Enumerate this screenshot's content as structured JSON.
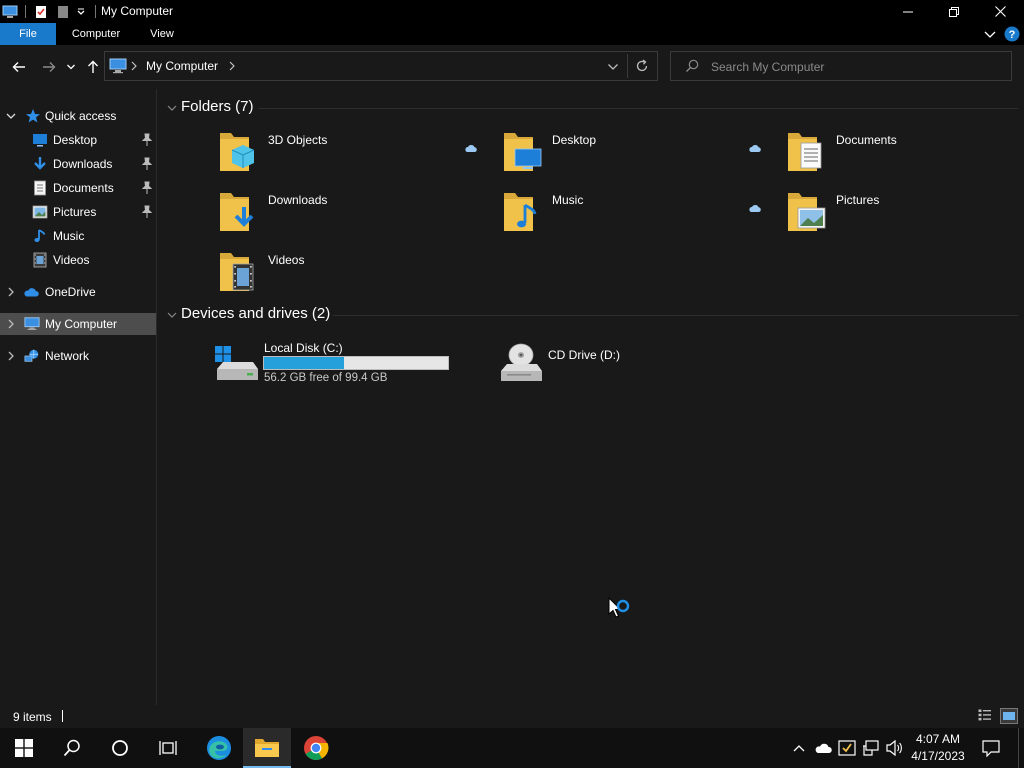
{
  "window": {
    "title": "My Computer"
  },
  "ribbon": {
    "tabs": [
      {
        "label": "File"
      },
      {
        "label": "Computer"
      },
      {
        "label": "View"
      }
    ]
  },
  "address": {
    "crumb": "My Computer",
    "search_placeholder": "Search My Computer"
  },
  "sidebar": {
    "quick_access": "Quick access",
    "quick_items": [
      {
        "label": "Desktop",
        "icon": "desktop-icon",
        "pinned": true
      },
      {
        "label": "Downloads",
        "icon": "downloads-icon",
        "pinned": true
      },
      {
        "label": "Documents",
        "icon": "documents-icon",
        "pinned": true
      },
      {
        "label": "Pictures",
        "icon": "pictures-icon",
        "pinned": true
      },
      {
        "label": "Music",
        "icon": "music-icon",
        "pinned": false
      },
      {
        "label": "Videos",
        "icon": "videos-icon",
        "pinned": false
      }
    ],
    "onedrive": "OneDrive",
    "my_computer": "My Computer",
    "network": "Network"
  },
  "folders": {
    "header": "Folders (7)",
    "items": [
      {
        "label": "3D Objects",
        "icon": "3d-objects-folder-icon",
        "cloud": true
      },
      {
        "label": "Desktop",
        "icon": "desktop-folder-icon",
        "cloud": true
      },
      {
        "label": "Documents",
        "icon": "documents-folder-icon",
        "cloud": false
      },
      {
        "label": "Downloads",
        "icon": "downloads-folder-icon",
        "cloud": false
      },
      {
        "label": "Music",
        "icon": "music-folder-icon",
        "cloud": true
      },
      {
        "label": "Pictures",
        "icon": "pictures-folder-icon",
        "cloud": false
      },
      {
        "label": "Videos",
        "icon": "videos-folder-icon",
        "cloud": false
      }
    ]
  },
  "drives": {
    "header": "Devices and drives (2)",
    "items": [
      {
        "label": "Local Disk (C:)",
        "free": "56.2 GB free of 99.4 GB",
        "used_fraction": 0.4346,
        "icon": "local-disk-icon"
      },
      {
        "label": "CD Drive (D:)",
        "icon": "cd-drive-icon"
      }
    ]
  },
  "status": {
    "items_count": "9 items"
  },
  "taskbar": {
    "time": "4:07 AM",
    "date": "4/17/2023"
  },
  "colors": {
    "accent": "#1979ca",
    "drive_fill": "#26a0da",
    "folder": "#f0c24a",
    "background": "#191919"
  }
}
